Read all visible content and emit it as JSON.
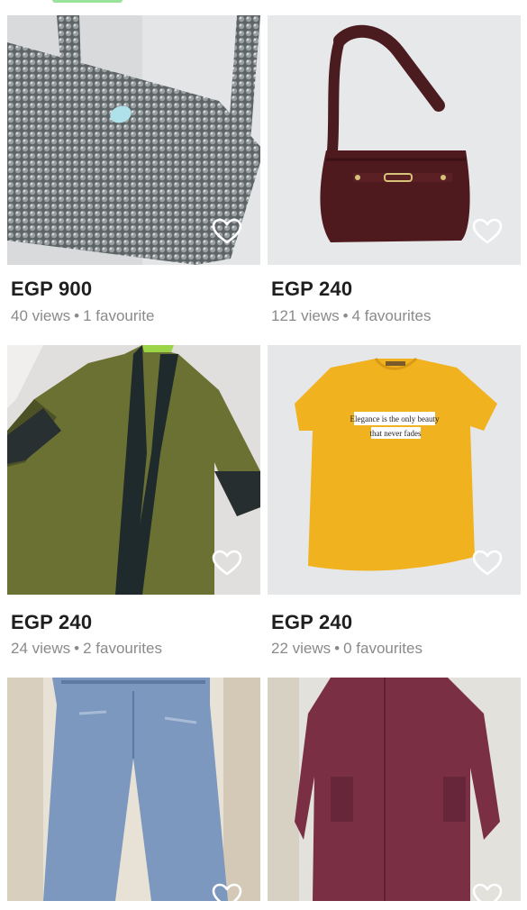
{
  "listings": [
    {
      "price": "EGP 900",
      "views": "40 views",
      "favourites": "1 favourite",
      "image": "beaded-silver-bag",
      "icon": "heart-outline-icon"
    },
    {
      "price": "EGP 240",
      "views": "121 views",
      "favourites": "4 favourites",
      "image": "burgundy-shoulder-bag",
      "icon": "heart-outline-icon"
    },
    {
      "price": "EGP 240",
      "views": "24 views",
      "favourites": "2 favourites",
      "image": "olive-green-cardigan",
      "icon": "heart-outline-icon"
    },
    {
      "price": "EGP 240",
      "views": "22 views",
      "favourites": "0 favourites",
      "image": "mustard-t-shirt",
      "icon": "heart-outline-icon"
    },
    {
      "image": "blue-denim-jeans",
      "icon": "heart-outline-icon"
    },
    {
      "image": "burgundy-long-cardigan",
      "icon": "heart-outline-icon"
    }
  ],
  "tshirt_print": {
    "line1": "Elegance is the only beauty",
    "line2": "that never fades"
  },
  "separator": "•"
}
